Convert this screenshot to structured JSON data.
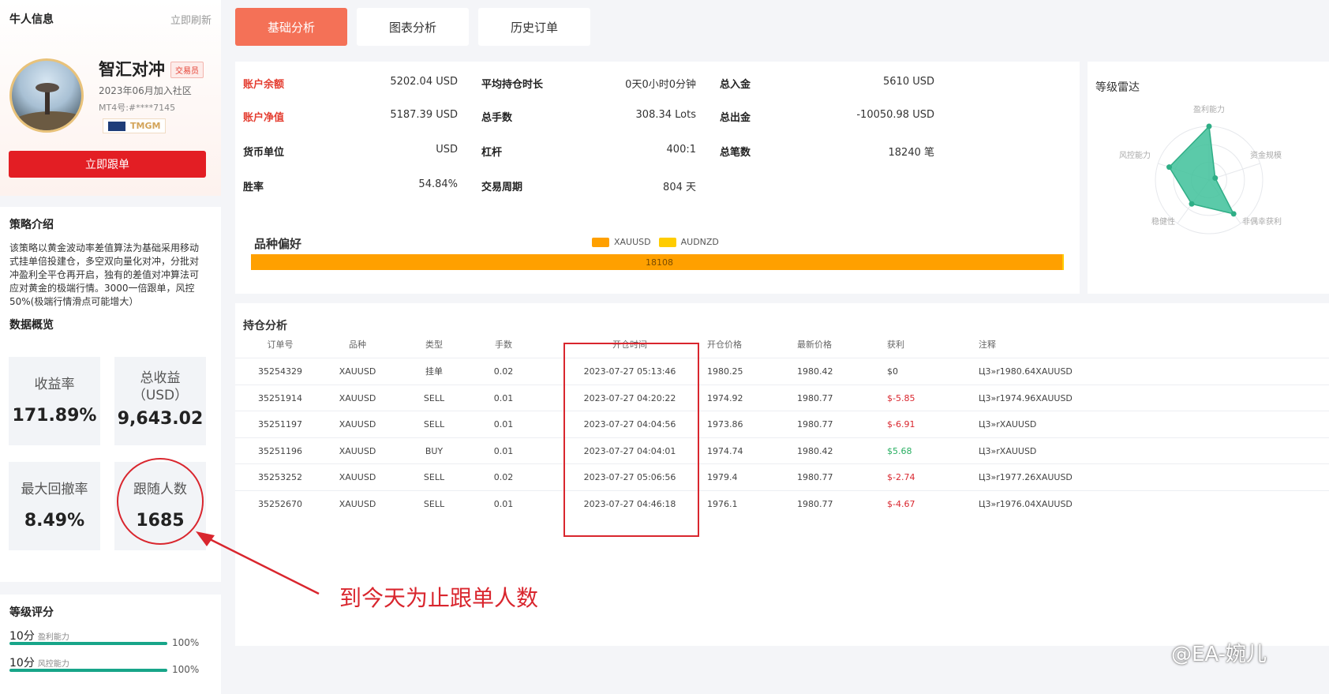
{
  "profile": {
    "section_title": "牛人信息",
    "refresh": "立即刷新",
    "name": "智汇对冲",
    "tag": "交易员",
    "joined": "2023年06月加入社区",
    "mt4": "MT4号:#****7145",
    "broker": "TMGM",
    "follow_button": "立即跟单"
  },
  "strategy": {
    "title": "策略介绍",
    "description": "该策略以黄金波动率差值算法为基础采用移动式挂单倍投建仓，多空双向量化对冲，分批对冲盈利全平仓再开启，独有的差值对冲算法可应对黄金的极端行情。3000一倍跟单，风控50%(极端行情滑点可能增大）"
  },
  "overview": {
    "title": "数据概览",
    "items": [
      {
        "label": "收益率",
        "value": "171.89%"
      },
      {
        "label": "总收益\n（USD）",
        "value": "9,643.02"
      },
      {
        "label": "最大回撤率",
        "value": "8.49%"
      },
      {
        "label": "跟随人数",
        "value": "1685"
      }
    ]
  },
  "grade": {
    "title": "等级评分",
    "items": [
      {
        "score": "10分",
        "name": "盈利能力",
        "pct": "100%",
        "fill": 1.0
      },
      {
        "score": "10分",
        "name": "风控能力",
        "pct": "100%",
        "fill": 1.0
      }
    ]
  },
  "tabs": [
    {
      "label": "基础分析",
      "active": true
    },
    {
      "label": "图表分析",
      "active": false
    },
    {
      "label": "历史订单",
      "active": false
    }
  ],
  "account": {
    "col1": [
      {
        "k": "账户余额",
        "v": "5202.04 USD",
        "red": true
      },
      {
        "k": "账户净值",
        "v": "5187.39 USD",
        "red": true
      },
      {
        "k": "货币单位",
        "v": "USD",
        "red": false
      },
      {
        "k": "胜率",
        "v": "54.84%",
        "red": false
      }
    ],
    "col2": [
      {
        "k": "平均持仓时长",
        "v": "0天0小时0分钟"
      },
      {
        "k": "总手数",
        "v": "308.34 Lots"
      },
      {
        "k": "杠杆",
        "v": "400:1"
      },
      {
        "k": "交易周期",
        "v": "804 天"
      }
    ],
    "col3": [
      {
        "k": "总入金",
        "v": "5610 USD"
      },
      {
        "k": "总出金",
        "v": "-10050.98 USD"
      },
      {
        "k": "总笔数",
        "v": "18240 笔"
      }
    ]
  },
  "preference": {
    "title": "品种偏好",
    "legend": [
      {
        "name": "XAUUSD",
        "color": "#ffa000"
      },
      {
        "name": "AUDNZD",
        "color": "#ffcc00"
      }
    ],
    "bar_value": "18108",
    "bar_end_value": "0"
  },
  "radar": {
    "title": "等级雷达",
    "axes": [
      "盈利能力",
      "资金规模",
      "非偶幸获利",
      "稳健性",
      "风控能力"
    ],
    "values": [
      1.0,
      0.12,
      0.78,
      0.55,
      0.78
    ],
    "color": "#3ec19a"
  },
  "holdings": {
    "title": "持仓分析",
    "columns": [
      "订单号",
      "品种",
      "类型",
      "手数",
      "开仓时间",
      "开仓价格",
      "最新价格",
      "获利",
      "注释"
    ],
    "rows": [
      [
        "35254329",
        "XAUUSD",
        "挂单",
        "0.02",
        "2023-07-27 05:13:46",
        "1980.25",
        "1980.42",
        "$0",
        "Ц3»r1980.64XAUUSD"
      ],
      [
        "35251914",
        "XAUUSD",
        "SELL",
        "0.01",
        "2023-07-27 04:20:22",
        "1974.92",
        "1980.77",
        "$-5.85",
        "Ц3»r1974.96XAUUSD"
      ],
      [
        "35251197",
        "XAUUSD",
        "SELL",
        "0.01",
        "2023-07-27 04:04:56",
        "1973.86",
        "1980.77",
        "$-6.91",
        "Ц3»rXAUUSD"
      ],
      [
        "35251196",
        "XAUUSD",
        "BUY",
        "0.01",
        "2023-07-27 04:04:01",
        "1974.74",
        "1980.42",
        "$5.68",
        "Ц3»rXAUUSD"
      ],
      [
        "35253252",
        "XAUUSD",
        "SELL",
        "0.02",
        "2023-07-27 05:06:56",
        "1979.4",
        "1980.77",
        "$-2.74",
        "Ц3»r1977.26XAUUSD"
      ],
      [
        "35252670",
        "XAUUSD",
        "SELL",
        "0.01",
        "2023-07-27 04:46:18",
        "1976.1",
        "1980.77",
        "$-4.67",
        "Ц3»r1976.04XAUUSD"
      ]
    ]
  },
  "annotation": "到今天为止跟单人数",
  "watermark": "@EA-婉儿",
  "colors": {
    "accent": "#f47157",
    "red": "#e31e24",
    "green": "#27ae60",
    "teal": "#17a589"
  }
}
